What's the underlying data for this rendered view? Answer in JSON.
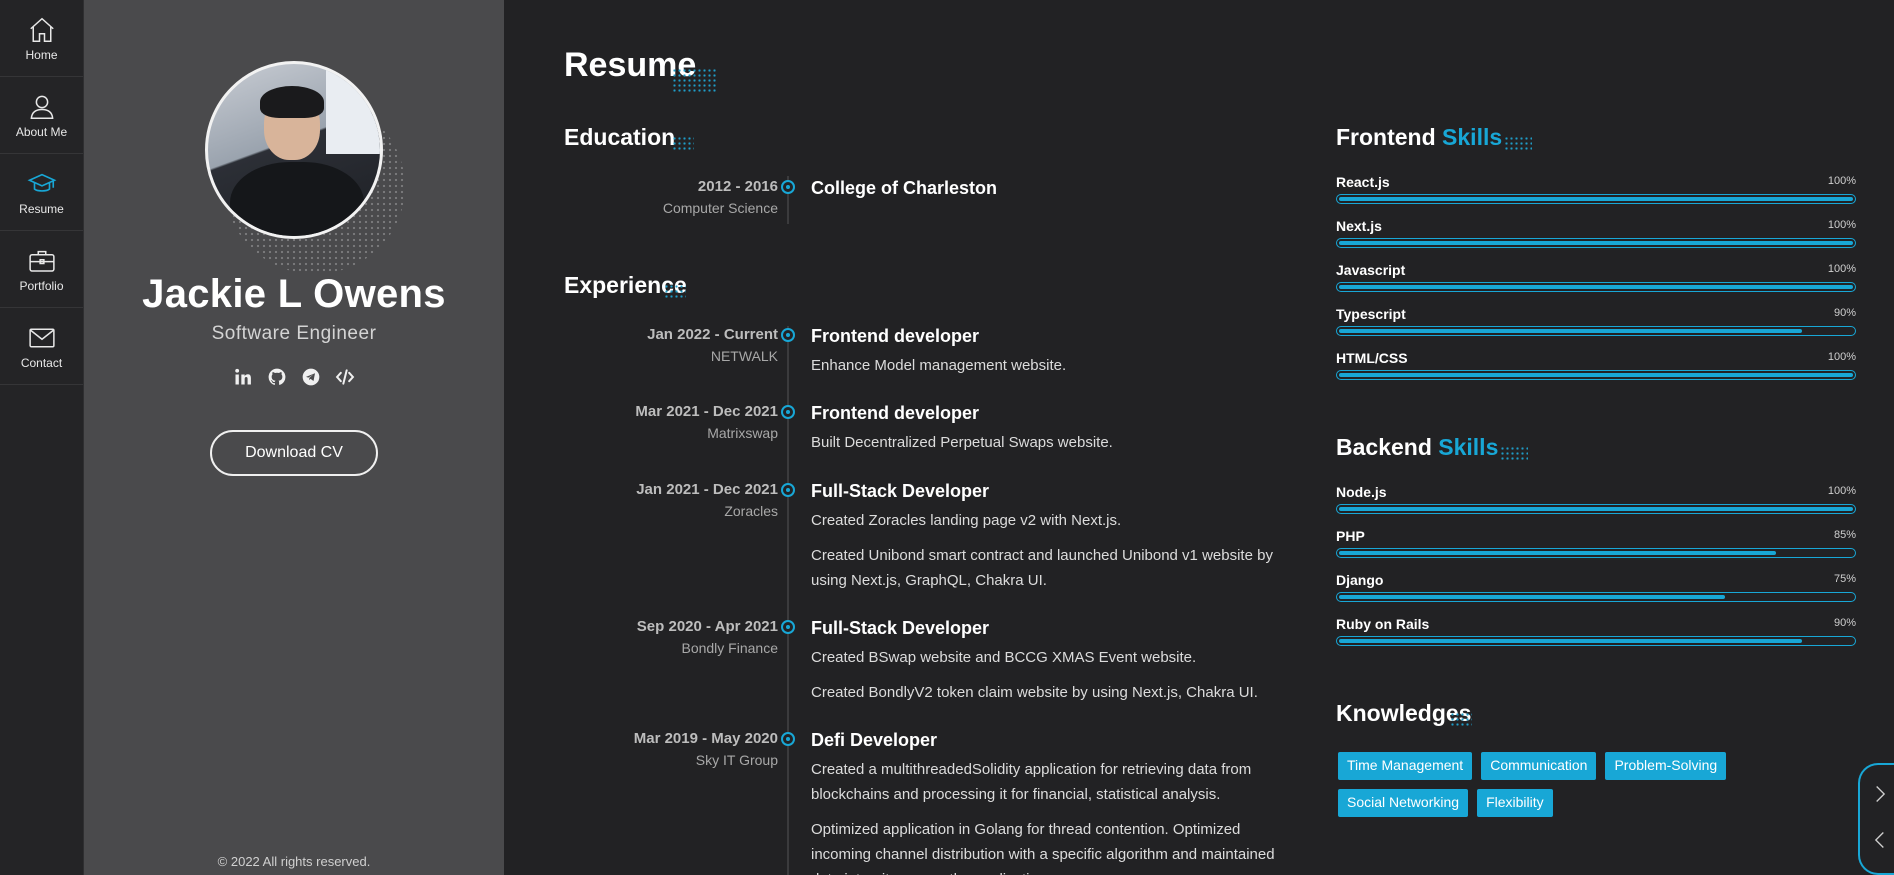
{
  "nav": {
    "items": [
      {
        "label": "Home",
        "icon": "home-icon"
      },
      {
        "label": "About Me",
        "icon": "user-icon"
      },
      {
        "label": "Resume",
        "icon": "graduation-cap-icon",
        "active": true
      },
      {
        "label": "Portfolio",
        "icon": "briefcase-icon"
      },
      {
        "label": "Contact",
        "icon": "envelope-icon"
      }
    ]
  },
  "profile": {
    "name": "Jackie L Owens",
    "role": "Software Engineer",
    "socials": [
      "linkedin-icon",
      "github-icon",
      "telegram-icon",
      "code-icon"
    ],
    "download_label": "Download CV",
    "copyright": "© 2022 All rights reserved."
  },
  "main": {
    "title": "Resume",
    "education_heading": "Education",
    "experience_heading": "Experience",
    "education": [
      {
        "dates": "2012 - 2016",
        "org": "Computer Science",
        "title": "College of Charleston",
        "desc": []
      }
    ],
    "experience": [
      {
        "dates": "Jan 2022 - Current",
        "org": "NETWALK",
        "title": "Frontend developer",
        "desc": [
          "Enhance Model management website."
        ]
      },
      {
        "dates": "Mar 2021 - Dec 2021",
        "org": "Matrixswap",
        "title": "Frontend developer",
        "desc": [
          "Built Decentralized Perpetual Swaps website."
        ]
      },
      {
        "dates": "Jan 2021 - Dec 2021",
        "org": "Zoracles",
        "title": "Full-Stack Developer",
        "desc": [
          "Created Zoracles landing page v2 with Next.js.",
          "Created Unibond smart contract and launched Unibond v1 website by using Next.js, GraphQL, Chakra UI."
        ]
      },
      {
        "dates": "Sep 2020 - Apr 2021",
        "org": "Bondly Finance",
        "title": "Full-Stack Developer",
        "desc": [
          "Created BSwap website and BCCG XMAS Event website.",
          "Created BondlyV2 token claim website by using Next.js, Chakra UI."
        ]
      },
      {
        "dates": "Mar 2019 - May 2020",
        "org": "Sky IT Group",
        "title": "Defi Developer",
        "desc": [
          "Created a multithreadedSolidity application for retrieving data from blockchains and processing it for financial, statistical analysis.",
          "Optimized application in Golang for thread contention. Optimized incoming channel distribution with a specific algorithm and maintained data integrity across the application."
        ]
      }
    ]
  },
  "frontend": {
    "heading_a": "Frontend",
    "heading_b": "Skills",
    "skills": [
      {
        "name": "React.js",
        "pct": "100%",
        "level": 1.0
      },
      {
        "name": "Next.js",
        "pct": "100%",
        "level": 1.0
      },
      {
        "name": "Javascript",
        "pct": "100%",
        "level": 1.0
      },
      {
        "name": "Typescript",
        "pct": "90%",
        "level": 0.9
      },
      {
        "name": "HTML/CSS",
        "pct": "100%",
        "level": 1.0
      }
    ]
  },
  "backend": {
    "heading_a": "Backend",
    "heading_b": "Skills",
    "skills": [
      {
        "name": "Node.js",
        "pct": "100%",
        "level": 1.0
      },
      {
        "name": "PHP",
        "pct": "85%",
        "level": 0.85
      },
      {
        "name": "Django",
        "pct": "75%",
        "level": 0.75
      },
      {
        "name": "Ruby on Rails",
        "pct": "90%",
        "level": 0.9
      }
    ]
  },
  "knowledges": {
    "heading": "Knowledges",
    "tags": [
      "Time Management",
      "Communication",
      "Problem-Solving",
      "Social Networking",
      "Flexibility"
    ]
  },
  "colors": {
    "accent": "#18a7d6",
    "panel": "#4a4a4c",
    "background": "#222224"
  }
}
